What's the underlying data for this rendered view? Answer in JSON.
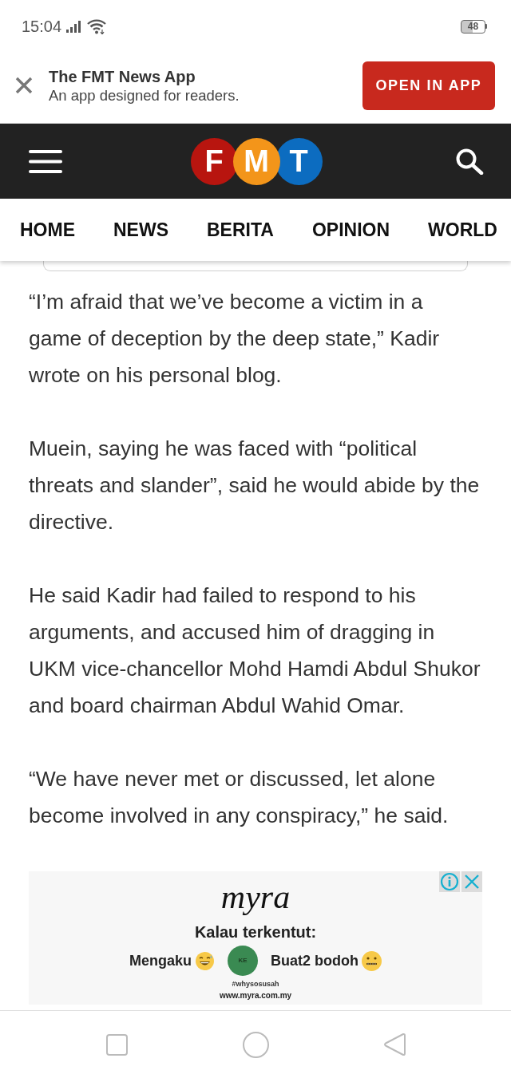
{
  "status_bar": {
    "time": "15:04",
    "battery": "48"
  },
  "app_banner": {
    "title": "The FMT News App",
    "subtitle": "An app designed for readers.",
    "button": "OPEN IN APP"
  },
  "header": {
    "logo": [
      {
        "letter": "F",
        "color": "#b8150f"
      },
      {
        "letter": "M",
        "color": "#f3951a"
      },
      {
        "letter": "T",
        "color": "#0c6cc0"
      }
    ]
  },
  "nav_tabs": [
    "HOME",
    "NEWS",
    "BERITA",
    "OPINION",
    "WORLD"
  ],
  "article": {
    "paragraphs": [
      "“I’m afraid that we’ve become a victim in a game of deception by the deep state,” Kadir wrote on his personal blog.",
      "Muein, saying he was faced with “political threats and slander”, said he would abide by the directive.",
      "He said Kadir had failed to respond to his arguments, and accused him of dragging in UKM vice-chancellor Mohd Hamdi Abdul Shukor and board chairman Abdul Wahid Omar.",
      "“We have never met or discussed, let alone become involved in any conspiracy,” he said."
    ]
  },
  "ad": {
    "brand": "myra",
    "headline": "Kalau terkentut:",
    "option_left": "Mengaku",
    "badge": "KE",
    "option_right": "Buat2 bodoh",
    "hashtag": "#whysosusah",
    "url": "www.myra.com.my"
  }
}
